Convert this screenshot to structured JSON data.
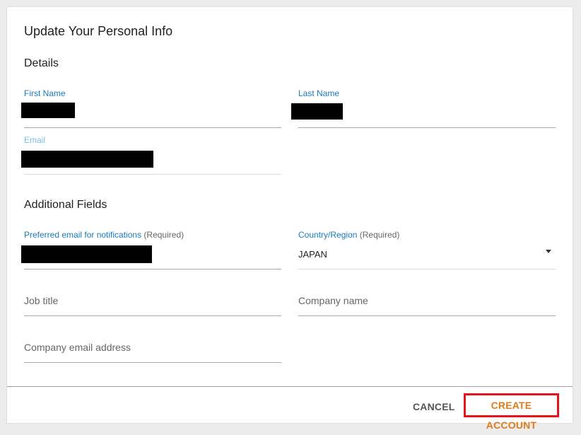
{
  "dialog": {
    "title": "Update Your Personal Info"
  },
  "details": {
    "section_title": "Details",
    "first_name": {
      "label": "First Name",
      "value": ""
    },
    "last_name": {
      "label": "Last Name",
      "value": ""
    },
    "email": {
      "label": "Email",
      "value": ""
    }
  },
  "additional": {
    "section_title": "Additional Fields",
    "preferred_email": {
      "label": "Preferred email for notifications",
      "required": "(Required)",
      "value": ""
    },
    "country": {
      "label": "Country/Region",
      "required": "(Required)",
      "value": "JAPAN"
    },
    "job_title": {
      "placeholder": "Job title"
    },
    "company_name": {
      "placeholder": "Company name"
    },
    "company_email": {
      "placeholder": "Company email address"
    }
  },
  "footer": {
    "cancel_label": "CANCEL",
    "create_label": "CREATE ACCOUNT"
  },
  "colors": {
    "label_blue": "#1a7bbd",
    "accent_orange": "#e07b1b",
    "highlight_red": "#e3151a"
  }
}
